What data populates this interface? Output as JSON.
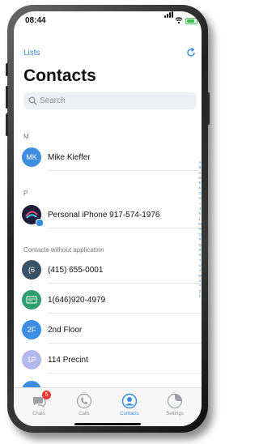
{
  "status_bar": {
    "time": "08:44"
  },
  "nav": {
    "lists_label": "Lists"
  },
  "page_title": "Contacts",
  "search": {
    "placeholder": "Search"
  },
  "sections": [
    {
      "header": "M",
      "contacts": [
        {
          "initials": "MK",
          "name": "Mike Kieffer",
          "color": "#3d8ee0"
        }
      ]
    },
    {
      "header": "P",
      "contacts": [
        {
          "initials": "",
          "name": "Personal iPhone 917-574-1976",
          "color": "#1c1f3a"
        }
      ]
    },
    {
      "header": "Contacts without application",
      "contacts": [
        {
          "initials": "(6",
          "name": "(415) 655-0001",
          "color": "#3a5268"
        },
        {
          "initials": "",
          "name": "1(646)920-4979",
          "color": "#2f9e72"
        },
        {
          "initials": "2F",
          "name": "2nd Floor",
          "color": "#3d8ee0"
        },
        {
          "initials": "1P",
          "name": "114 Precint",
          "color": "#b3b9ea"
        }
      ]
    }
  ],
  "index_letters": [
    "A",
    "B",
    "C",
    "D",
    "E",
    "F",
    "G",
    "H",
    "I",
    "J",
    "K",
    "L",
    "M",
    "N",
    "O",
    "P",
    "Q",
    "R",
    "S",
    "T",
    "U",
    "V",
    "W",
    "X",
    "Y",
    "Z",
    "#"
  ],
  "tabs": [
    {
      "label": "Chats",
      "badge": "5",
      "active": false
    },
    {
      "label": "Calls",
      "active": false
    },
    {
      "label": "Contacts",
      "active": true
    },
    {
      "label": "Settings",
      "active": false
    }
  ],
  "colors": {
    "accent": "#2f8de4",
    "badge": "#e53935"
  }
}
